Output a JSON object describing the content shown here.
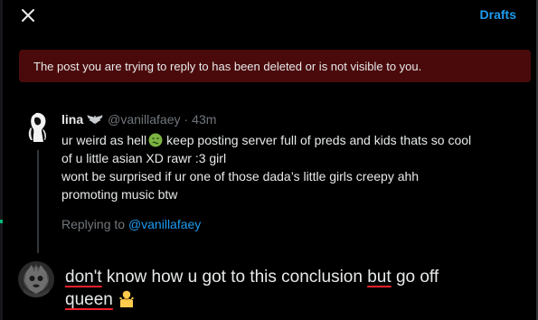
{
  "header": {
    "close_icon": "close-icon",
    "drafts_label": "Drafts"
  },
  "alert": {
    "text": "The post you are trying to reply to has been deleted or is not visible to you."
  },
  "quoted_post": {
    "author_name": "lina",
    "name_icon": "bat-icon",
    "handle": "@vanillafaey",
    "separator": "·",
    "time": "43m",
    "lines": [
      "ur weird as hell",
      "keep posting server full of preds and kids thats so cool",
      "of u little asian XD rawr :3 girl",
      "wont be surprised if ur one of those dada’s little girls creepy ahh",
      "promoting music btw"
    ],
    "emoji": "sick-face-emoji",
    "replying_prefix": "Replying to",
    "replying_mention": "@vanillafaey"
  },
  "composer": {
    "words": [
      "don't",
      "know how u got to this conclusion",
      "but",
      "go off",
      "queen"
    ],
    "emoji": "person-shrugging-emoji"
  },
  "colors": {
    "background": "#000000",
    "accent": "#1d9bf0",
    "alert_bg": "#4a0a0b",
    "muted": "#71767b",
    "text": "#e7e9ea",
    "spellcheck": "#f4212e"
  }
}
